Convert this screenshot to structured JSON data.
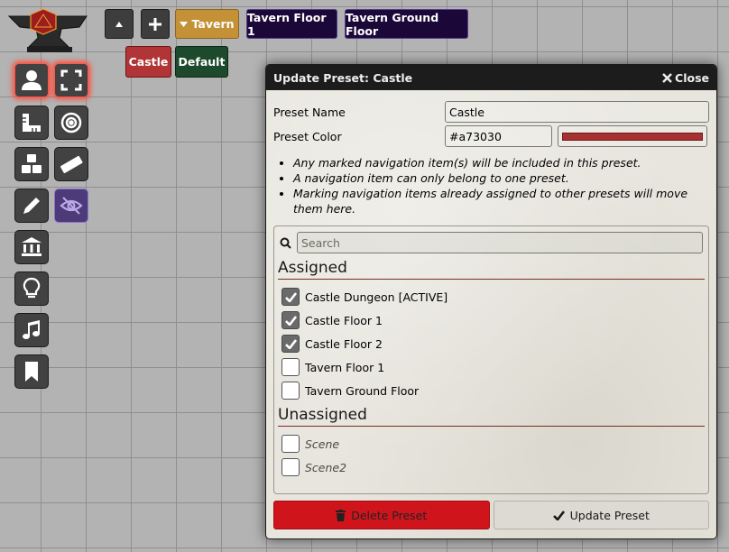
{
  "nav": {
    "up_icon": "caret-up-icon",
    "add_icon": "plus-icon",
    "presets": [
      {
        "label": "Tavern",
        "color": "#c49136",
        "has_caret": true
      },
      {
        "label": "Tavern Floor 1"
      },
      {
        "label": "Tavern Ground Floor"
      },
      {
        "label": "Castle",
        "color": "#a73030"
      },
      {
        "label": "Default"
      }
    ]
  },
  "toolbar": {
    "icons": [
      "user-icon",
      "expand-icon",
      "ruler-icon",
      "target-icon",
      "cubes-icon",
      "tape-measure-icon",
      "pencil-icon",
      "eye-slash-icon",
      "landmark-icon",
      "lightbulb-icon",
      "music-icon",
      "bookmark-icon"
    ]
  },
  "dialog": {
    "title": "Update Preset: Castle",
    "close_label": "Close",
    "name_label": "Preset Name",
    "name_value": "Castle",
    "color_label": "Preset Color",
    "color_value": "#a73030",
    "notes": [
      "Any marked navigation item(s) will be included in this preset.",
      "A navigation item can only belong to one preset.",
      "Marking navigation items already assigned to other presets will move them here."
    ],
    "search_placeholder": "Search",
    "assigned_heading": "Assigned",
    "unassigned_heading": "Unassigned",
    "assigned": [
      {
        "label": "Castle Dungeon [ACTIVE]",
        "checked": true
      },
      {
        "label": "Castle Floor 1",
        "checked": true
      },
      {
        "label": "Castle Floor 2",
        "checked": true
      },
      {
        "label": "Tavern Floor 1",
        "checked": false
      },
      {
        "label": "Tavern Ground Floor",
        "checked": false
      }
    ],
    "unassigned": [
      {
        "label": "Scene",
        "checked": false
      },
      {
        "label": "Scene2",
        "checked": false
      }
    ],
    "delete_label": "Delete Preset",
    "update_label": "Update Preset"
  }
}
